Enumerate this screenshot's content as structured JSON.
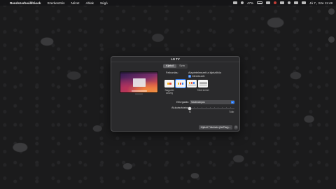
{
  "menubar": {
    "apple": "",
    "app": "Rendszerbeállítások",
    "items": [
      "Szerkesztés",
      "Nézet",
      "Ablak",
      "Súgó"
    ],
    "status": {
      "battery_percent": "47%",
      "input": "",
      "temp": "",
      "wifi_label": "",
      "datetime": "Jú 7., Sze 11:48"
    }
  },
  "window": {
    "title": "LG TV",
    "tabs": [
      {
        "label": "Kijelző",
        "active": true
      },
      {
        "label": "Szín",
        "active": false
      }
    ],
    "resolution_label": "Felbontás:",
    "radio": {
      "label": "Alapértelmezett a kijelzőhöz",
      "option": "Méretezett"
    },
    "thumbnails": [
      {
        "caption": "Nagyobb szöveg",
        "selected": false
      },
      {
        "caption": "",
        "selected": true
      },
      {
        "caption": "",
        "selected": false
      },
      {
        "caption": "Több terület",
        "selected": false
      }
    ],
    "rotation": {
      "label": "Elforgatás:",
      "value": "Szabványos"
    },
    "underscan": {
      "label": "Alulpásztázás:",
      "min_label": "Ki",
      "max_label": "Több",
      "value_percent": 0
    },
    "bottom_button": "Kijelző Tükrözés (AirPlay)...",
    "help": "?"
  }
}
